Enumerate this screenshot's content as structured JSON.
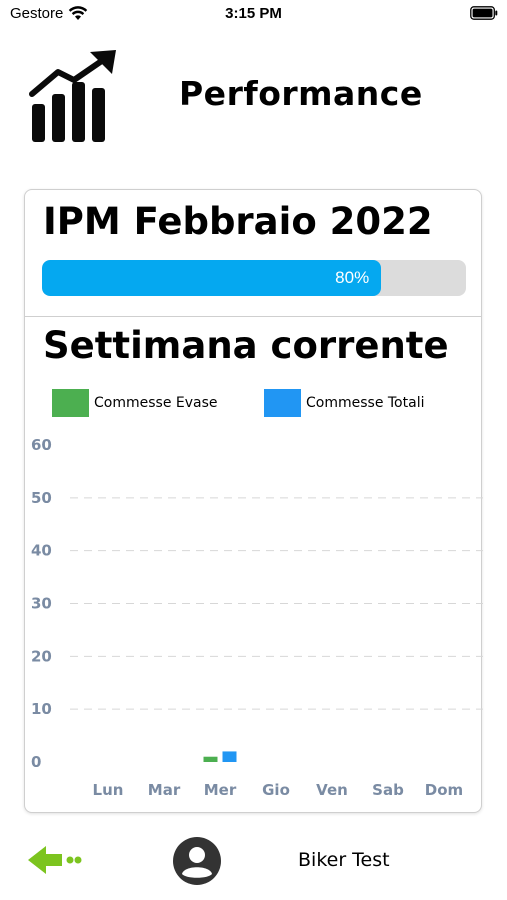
{
  "status_bar": {
    "carrier": "Gestore",
    "time": "3:15 PM",
    "wifi_icon": "wifi-icon",
    "battery_icon": "battery-icon"
  },
  "header": {
    "title": "Performance",
    "logo_icon": "bar-chart-growth-icon"
  },
  "ipm": {
    "title": "IPM Febbraio 2022",
    "progress_percent": 80,
    "progress_label": "80%",
    "progress_color": "#05a8f0"
  },
  "week": {
    "title": "Settimana corrente"
  },
  "chart_data": {
    "type": "bar",
    "categories": [
      "Lun",
      "Mar",
      "Mer",
      "Gio",
      "Ven",
      "Sab",
      "Dom"
    ],
    "series": [
      {
        "name": "Commesse Evase",
        "color": "#4caf50",
        "values": [
          0,
          0,
          1,
          0,
          0,
          0,
          0
        ]
      },
      {
        "name": "Commesse Totali",
        "color": "#2196f3",
        "values": [
          0,
          0,
          2,
          0,
          0,
          0,
          0
        ]
      }
    ],
    "ylim": [
      0,
      60
    ],
    "yticks": [
      0,
      10,
      20,
      30,
      40,
      50,
      60
    ],
    "grid": true,
    "legend": "top-left",
    "title": "",
    "xlabel": "",
    "ylabel": ""
  },
  "footer": {
    "back_icon": "arrow-left-icon",
    "back_color": "#7cc41f",
    "avatar_icon": "user-avatar-icon",
    "user_name": "Biker Test"
  }
}
